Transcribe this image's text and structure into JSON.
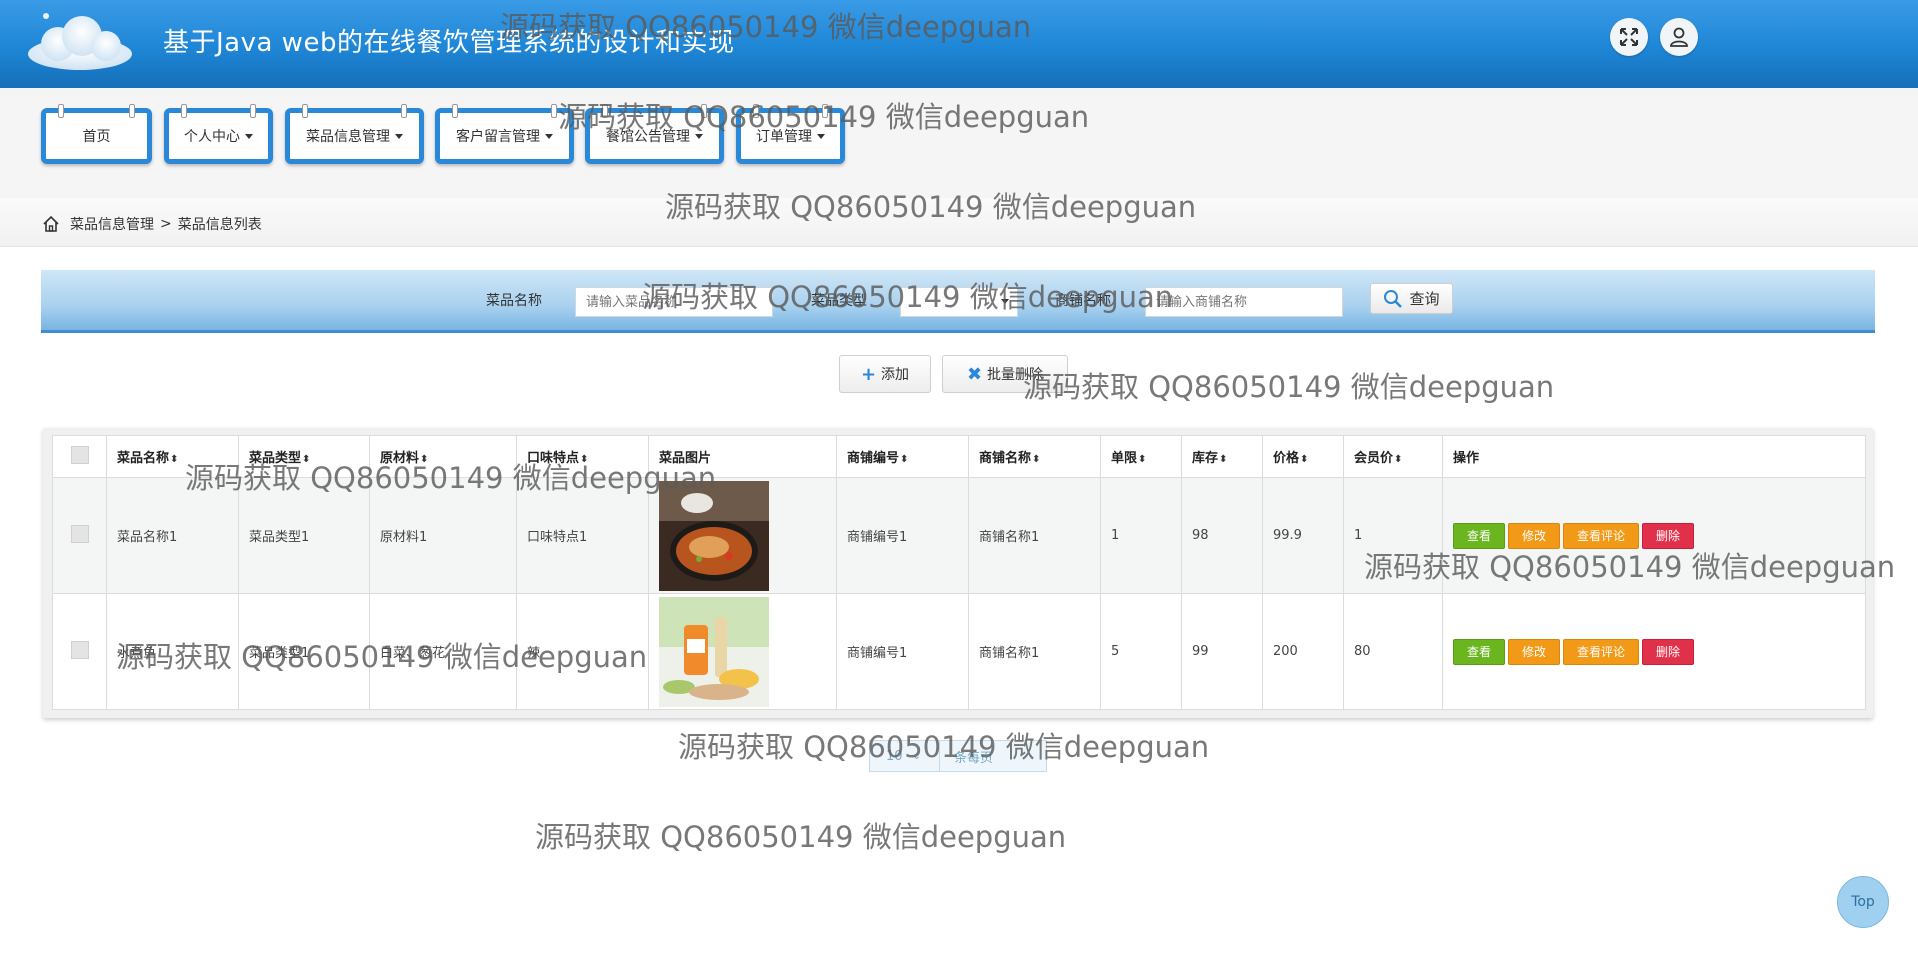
{
  "header": {
    "title": "基于Java web的在线餐饮管理系统的设计和实现",
    "fullscreen_icon": "expand-arrows-icon",
    "user_icon": "user-icon"
  },
  "nav": {
    "items": [
      {
        "label": "首页",
        "has_dropdown": false
      },
      {
        "label": "个人中心",
        "has_dropdown": true
      },
      {
        "label": "菜品信息管理",
        "has_dropdown": true
      },
      {
        "label": "客户留言管理",
        "has_dropdown": true
      },
      {
        "label": "餐馆公告管理",
        "has_dropdown": true
      },
      {
        "label": "订单管理",
        "has_dropdown": true
      }
    ]
  },
  "breadcrumb": {
    "home_icon": "home-icon",
    "section": "菜品信息管理",
    "separator": ">",
    "page": "菜品信息列表"
  },
  "search": {
    "name_label": "菜品名称",
    "name_placeholder": "请输入菜品名称",
    "type_label": "菜品类型",
    "type_value": "",
    "shop_label": "商铺名称",
    "shop_placeholder": "请输入商铺名称",
    "query_label": "查询"
  },
  "actions": {
    "add_label": "添加",
    "batch_delete_label": "批量删除"
  },
  "table": {
    "headers": [
      "菜品名称",
      "菜品类型",
      "原材料",
      "口味特点",
      "菜品图片",
      "商铺编号",
      "商铺名称",
      "单限",
      "库存",
      "价格",
      "会员价",
      "操作"
    ],
    "rows": [
      {
        "name": "菜品名称1",
        "type": "菜品类型1",
        "material": "原材料1",
        "taste": "口味特点1",
        "shop_no": "商铺编号1",
        "shop_name": "商铺名称1",
        "limit": "1",
        "stock": "98",
        "price": "99.9",
        "member_price": "1"
      },
      {
        "name": "水煮鱼",
        "type": "菜品类型1",
        "material": "白菜、葱花",
        "taste": "辣",
        "shop_no": "商铺编号1",
        "shop_name": "商铺名称1",
        "limit": "5",
        "stock": "99",
        "price": "200",
        "member_price": "80"
      }
    ],
    "op_labels": {
      "view": "查看",
      "edit": "修改",
      "comments": "查看评论",
      "delete": "删除"
    }
  },
  "pagination": {
    "page_size": "10",
    "unit": "条每页"
  },
  "watermark": "源码获取 QQ86050149 微信deepguan",
  "top_button": "Top"
}
